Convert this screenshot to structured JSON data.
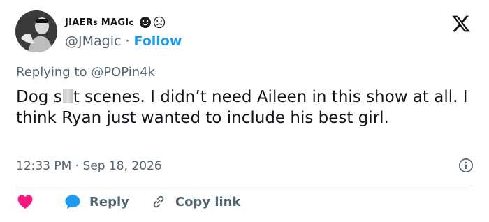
{
  "author": {
    "display_name": "JIAERs MAGIc",
    "handle": "@JMagic",
    "follow_label": "Follow",
    "separator": "·"
  },
  "reply_to": {
    "prefix": "Replying to",
    "mention": "@POPin4k"
  },
  "tweet": {
    "text_before_censor": "Dog s",
    "text_after_censor": "t scenes. I didn’t need Aileen in this show at all. I think Ryan just wanted to include his best girl."
  },
  "meta": {
    "time": "12:33 PM",
    "separator": "·",
    "date": "Sep 18, 2026"
  },
  "actions": {
    "reply_label": "Reply",
    "copy_link_label": "Copy link"
  },
  "colors": {
    "accent": "#1d9bf0",
    "heart": "#f91880",
    "muted": "#536471",
    "text": "#0f1419"
  },
  "icons": [
    "x-logo-icon",
    "smile-emoji-icon",
    "frown-emoji-icon",
    "info-icon",
    "heart-icon",
    "reply-bubble-icon",
    "link-icon"
  ]
}
